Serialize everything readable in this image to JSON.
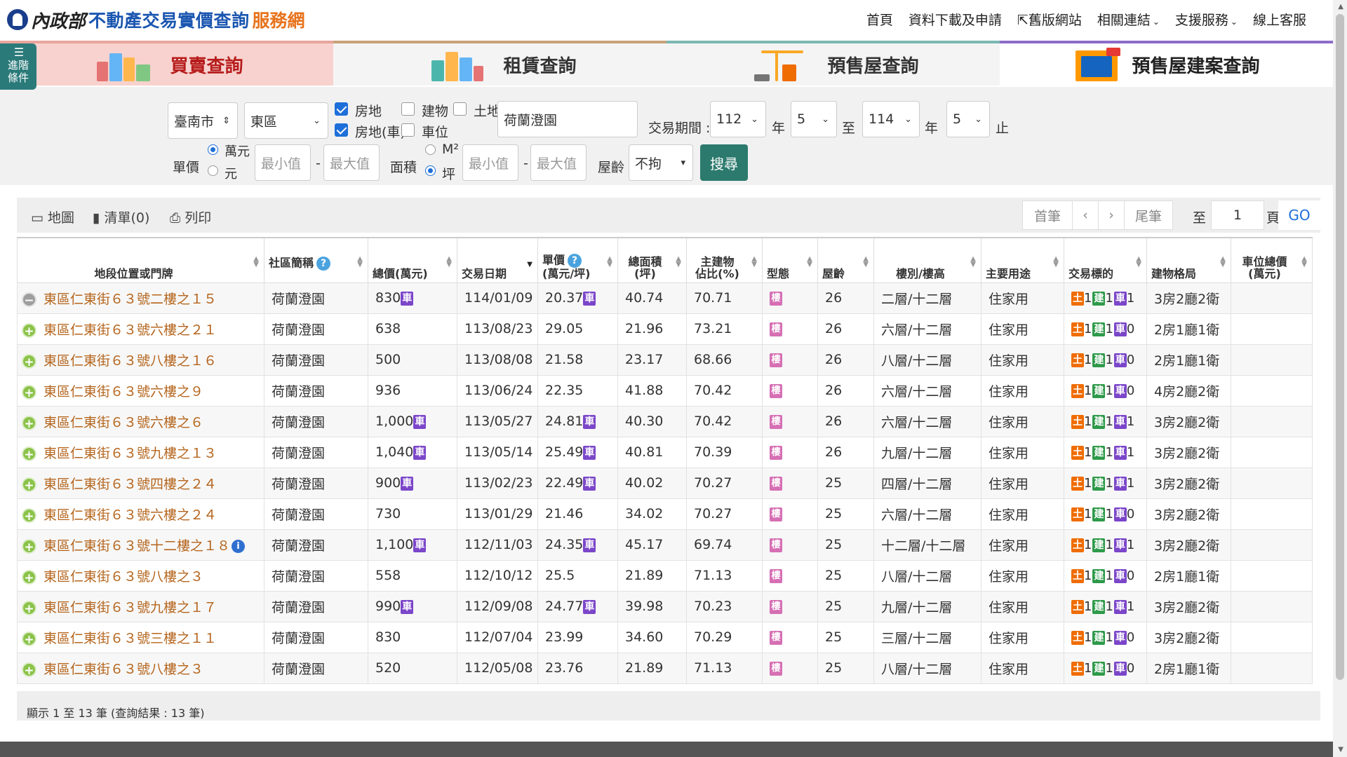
{
  "header": {
    "ministry": "內政部",
    "title": "不動產交易實價查詢",
    "title_accent": "服務網",
    "nav": [
      {
        "label": "首頁"
      },
      {
        "label": "資料下載及申請"
      },
      {
        "label": "舊版網站"
      },
      {
        "label": "相關連結"
      },
      {
        "label": "支援服務"
      },
      {
        "label": "線上客服"
      }
    ]
  },
  "advanced": {
    "line1": "進階",
    "line2": "條件"
  },
  "tabs": [
    {
      "label": "買賣查詢"
    },
    {
      "label": "租賃查詢"
    },
    {
      "label": "預售屋查詢"
    },
    {
      "label": "預售屋建案查詢"
    }
  ],
  "search": {
    "city": "臺南市",
    "district": "東區",
    "types": {
      "land_building": "房地",
      "building": "建物",
      "land": "土地",
      "land_building_car": "房地(車)",
      "parking": "車位"
    },
    "keyword": "荷蘭澄園",
    "period_label": "交易期間 :",
    "from_year": "112",
    "year_unit": "年",
    "from_month": "5",
    "to_label": "至",
    "to_year": "114",
    "to_month": "5",
    "end_label": "止",
    "unit_price_label": "單價",
    "unit_wan": "萬元",
    "unit_yuan": "元",
    "min_placeholder": "最小值",
    "max_placeholder": "最大值",
    "dash": "-",
    "area_label": "面積",
    "area_m2": "M²",
    "area_ping": "坪",
    "age_label": "屋齡",
    "age_value": "不拘",
    "submit": "搜尋"
  },
  "toolbar": {
    "map": "地圖",
    "list": "清單(0)",
    "print": "列印",
    "first": "首筆",
    "prev": "‹",
    "next": "›",
    "last": "尾筆",
    "to": "至",
    "page": "1",
    "page_unit": "頁",
    "go": "GO"
  },
  "columns": {
    "address": "地段位置或門牌",
    "community": "社區簡稱",
    "total_price": "總價(萬元)",
    "date": "交易日期",
    "unit_price_1": "單價",
    "unit_price_2": "(萬元/坪)",
    "area_1": "總面積",
    "area_2": "(坪)",
    "main_ratio_1": "主建物",
    "main_ratio_2": "佔比(%)",
    "type": "型態",
    "age": "屋齡",
    "floor": "樓別/樓高",
    "usage": "主要用途",
    "target": "交易標的",
    "layout": "建物格局",
    "park_price_1": "車位總價",
    "park_price_2": "(萬元)"
  },
  "tags": {
    "car": "車",
    "building_type": "樓",
    "land": "土",
    "build": "建",
    "park": "車"
  },
  "rows": [
    {
      "address": "東區仁東街６３號二樓之１５",
      "community": "荷蘭澄園",
      "total": "830",
      "total_car": true,
      "date": "114/01/09",
      "unit": "20.37",
      "unit_car": true,
      "area": "40.74",
      "ratio": "70.71",
      "age": "26",
      "floor": "二層/十二層",
      "usage": "住家用",
      "land": "1",
      "build": "1",
      "park": "1",
      "layout": "3房2廳2衛",
      "expanded": true
    },
    {
      "address": "東區仁東街６３號六樓之２１",
      "community": "荷蘭澄園",
      "total": "638",
      "total_car": false,
      "date": "113/08/23",
      "unit": "29.05",
      "unit_car": false,
      "area": "21.96",
      "ratio": "73.21",
      "age": "26",
      "floor": "六層/十二層",
      "usage": "住家用",
      "land": "1",
      "build": "1",
      "park": "0",
      "layout": "2房1廳1衛"
    },
    {
      "address": "東區仁東街６３號八樓之１６",
      "community": "荷蘭澄園",
      "total": "500",
      "total_car": false,
      "date": "113/08/08",
      "unit": "21.58",
      "unit_car": false,
      "area": "23.17",
      "ratio": "68.66",
      "age": "26",
      "floor": "八層/十二層",
      "usage": "住家用",
      "land": "1",
      "build": "1",
      "park": "0",
      "layout": "2房1廳1衛"
    },
    {
      "address": "東區仁東街６３號六樓之９",
      "community": "荷蘭澄園",
      "total": "936",
      "total_car": false,
      "date": "113/06/24",
      "unit": "22.35",
      "unit_car": false,
      "area": "41.88",
      "ratio": "70.42",
      "age": "26",
      "floor": "六層/十二層",
      "usage": "住家用",
      "land": "1",
      "build": "1",
      "park": "0",
      "layout": "4房2廳2衛"
    },
    {
      "address": "東區仁東街６３號六樓之６",
      "community": "荷蘭澄園",
      "total": "1,000",
      "total_car": true,
      "date": "113/05/27",
      "unit": "24.81",
      "unit_car": true,
      "area": "40.30",
      "ratio": "70.42",
      "age": "26",
      "floor": "六層/十二層",
      "usage": "住家用",
      "land": "1",
      "build": "1",
      "park": "1",
      "layout": "3房2廳2衛"
    },
    {
      "address": "東區仁東街６３號九樓之１３",
      "community": "荷蘭澄園",
      "total": "1,040",
      "total_car": true,
      "date": "113/05/14",
      "unit": "25.49",
      "unit_car": true,
      "area": "40.81",
      "ratio": "70.39",
      "age": "26",
      "floor": "九層/十二層",
      "usage": "住家用",
      "land": "1",
      "build": "1",
      "park": "1",
      "layout": "3房2廳2衛"
    },
    {
      "address": "東區仁東街６３號四樓之２４",
      "community": "荷蘭澄園",
      "total": "900",
      "total_car": true,
      "date": "113/02/23",
      "unit": "22.49",
      "unit_car": true,
      "area": "40.02",
      "ratio": "70.27",
      "age": "25",
      "floor": "四層/十二層",
      "usage": "住家用",
      "land": "1",
      "build": "1",
      "park": "1",
      "layout": "3房2廳2衛"
    },
    {
      "address": "東區仁東街６３號六樓之２４",
      "community": "荷蘭澄園",
      "total": "730",
      "total_car": false,
      "date": "113/01/29",
      "unit": "21.46",
      "unit_car": false,
      "area": "34.02",
      "ratio": "70.27",
      "age": "25",
      "floor": "六層/十二層",
      "usage": "住家用",
      "land": "1",
      "build": "1",
      "park": "0",
      "layout": "3房2廳2衛"
    },
    {
      "address": "東區仁東街６３號十二樓之１８",
      "community": "荷蘭澄園",
      "total": "1,100",
      "total_car": true,
      "date": "112/11/03",
      "unit": "24.35",
      "unit_car": true,
      "area": "45.17",
      "ratio": "69.74",
      "age": "25",
      "floor": "十二層/十二層",
      "usage": "住家用",
      "land": "1",
      "build": "1",
      "park": "1",
      "layout": "3房2廳2衛",
      "info": true
    },
    {
      "address": "東區仁東街６３號八樓之３",
      "community": "荷蘭澄園",
      "total": "558",
      "total_car": false,
      "date": "112/10/12",
      "unit": "25.5",
      "unit_car": false,
      "area": "21.89",
      "ratio": "71.13",
      "age": "25",
      "floor": "八層/十二層",
      "usage": "住家用",
      "land": "1",
      "build": "1",
      "park": "0",
      "layout": "2房1廳1衛"
    },
    {
      "address": "東區仁東街６３號九樓之１７",
      "community": "荷蘭澄園",
      "total": "990",
      "total_car": true,
      "date": "112/09/08",
      "unit": "24.77",
      "unit_car": true,
      "area": "39.98",
      "ratio": "70.23",
      "age": "25",
      "floor": "九層/十二層",
      "usage": "住家用",
      "land": "1",
      "build": "1",
      "park": "1",
      "layout": "3房2廳2衛"
    },
    {
      "address": "東區仁東街６３號三樓之１１",
      "community": "荷蘭澄園",
      "total": "830",
      "total_car": false,
      "date": "112/07/04",
      "unit": "23.99",
      "unit_car": false,
      "area": "34.60",
      "ratio": "70.29",
      "age": "25",
      "floor": "三層/十二層",
      "usage": "住家用",
      "land": "1",
      "build": "1",
      "park": "0",
      "layout": "3房2廳2衛"
    },
    {
      "address": "東區仁東街６３號八樓之３",
      "community": "荷蘭澄園",
      "total": "520",
      "total_car": false,
      "date": "112/05/08",
      "unit": "23.76",
      "unit_car": false,
      "area": "21.89",
      "ratio": "71.13",
      "age": "25",
      "floor": "八層/十二層",
      "usage": "住家用",
      "land": "1",
      "build": "1",
      "park": "0",
      "layout": "2房1廳1衛"
    }
  ],
  "footer": {
    "summary": "顯示 1 至 13 筆 (查詢結果 : 13 筆)"
  }
}
